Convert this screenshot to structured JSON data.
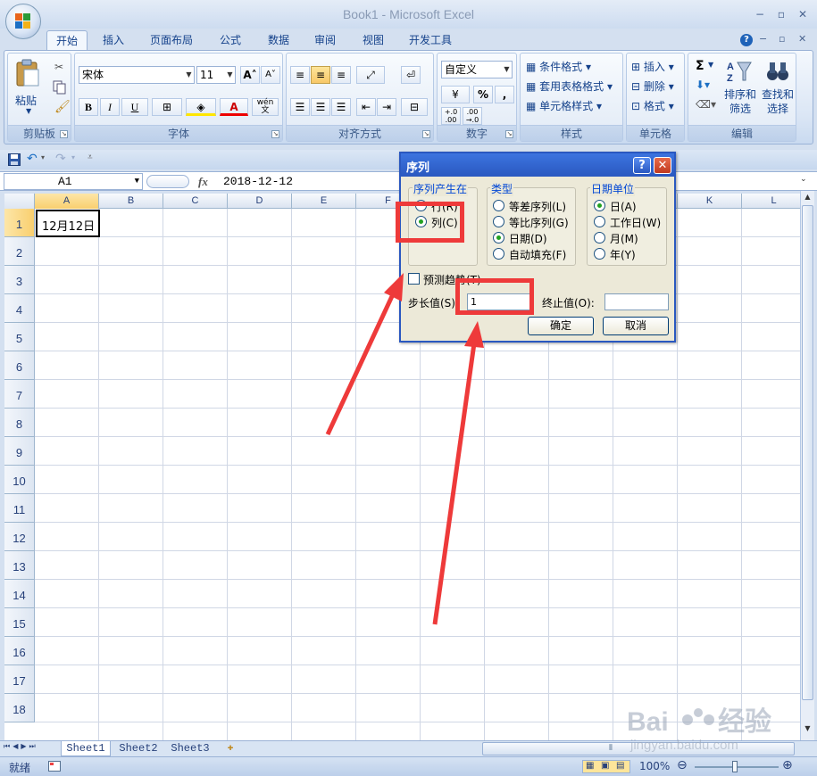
{
  "window": {
    "title": "Book1 - Microsoft Excel",
    "minimize": "−",
    "restore": "▫",
    "close": "✕"
  },
  "ribbon_tabs": [
    "开始",
    "插入",
    "页面布局",
    "公式",
    "数据",
    "审阅",
    "视图",
    "开发工具"
  ],
  "ribbon": {
    "clipboard": {
      "paste": "粘贴",
      "label": "剪贴板"
    },
    "font": {
      "name": "宋体",
      "size": "11",
      "label": "字体",
      "bold": "B",
      "italic": "I",
      "underline": "U",
      "grow": "A",
      "shrink": "A",
      "color": "A",
      "phonetic": "wén\n文"
    },
    "alignment": {
      "label": "对齐方式"
    },
    "number": {
      "format": "自定义",
      "percent": "%",
      "comma": ",",
      "inc_decimal": "+.0\n.00",
      "dec_decimal": ".00\n→.0",
      "label": "数字"
    },
    "styles": {
      "conditional": "条件格式",
      "table": "套用表格格式",
      "cell": "单元格样式",
      "label": "样式"
    },
    "cells": {
      "insert": "插入",
      "delete": "删除",
      "format": "格式",
      "label": "单元格"
    },
    "editing": {
      "sigma": "Σ",
      "sort": "排序和\n筛选",
      "find": "查找和\n选择",
      "label": "编辑"
    }
  },
  "formula_bar": {
    "name_box": "A1",
    "fx": "fx",
    "value": "2018-12-12"
  },
  "grid": {
    "columns": [
      "A",
      "B",
      "C",
      "D",
      "E",
      "F",
      "G",
      "H",
      "I",
      "J",
      "K",
      "L"
    ],
    "rows": [
      "1",
      "2",
      "3",
      "4",
      "5",
      "6",
      "7",
      "8",
      "9",
      "10",
      "11",
      "12",
      "13",
      "14",
      "15",
      "16",
      "17",
      "18"
    ],
    "a1_value": "12月12日",
    "selected_column": "A",
    "selected_row": "1"
  },
  "sheets": [
    "Sheet1",
    "Sheet2",
    "Sheet3"
  ],
  "active_sheet": "Sheet1",
  "status": {
    "ready": "就绪",
    "zoom": "100%"
  },
  "dialog": {
    "title": "序列",
    "help": "?",
    "close": "✕",
    "series_in": {
      "legend": "序列产生在",
      "options": [
        "行(R)",
        "列(C)"
      ],
      "selected": "列(C)"
    },
    "type": {
      "legend": "类型",
      "options": [
        "等差序列(L)",
        "等比序列(G)",
        "日期(D)",
        "自动填充(F)"
      ],
      "selected": "日期(D)"
    },
    "date_unit": {
      "legend": "日期单位",
      "options": [
        "日(A)",
        "工作日(W)",
        "月(M)",
        "年(Y)"
      ],
      "selected": "日(A)"
    },
    "trend": {
      "label": "预测趋势(T)",
      "checked": false
    },
    "step": {
      "label": "步长值(S):",
      "value": "1"
    },
    "stop": {
      "label": "终止值(O):",
      "value": ""
    },
    "ok": "确定",
    "cancel": "取消"
  },
  "annotation_color": "#ee3a3a",
  "watermark": {
    "brand": "Baidu经验",
    "url": "jingyan.baidu.com"
  }
}
